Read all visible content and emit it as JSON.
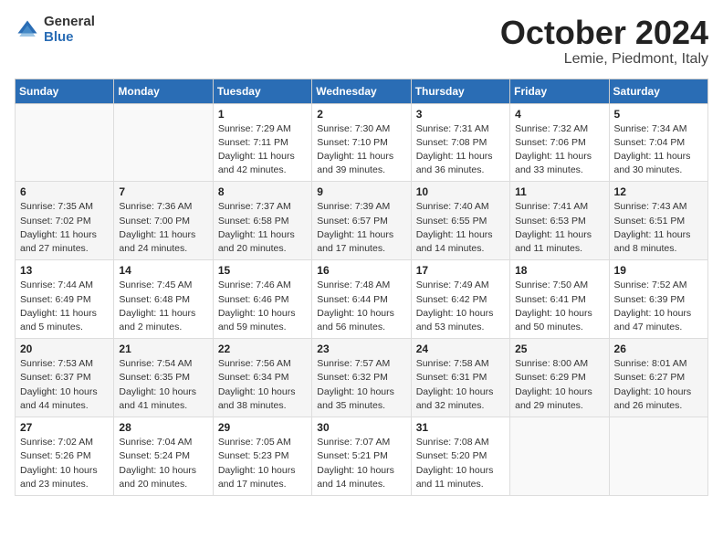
{
  "header": {
    "logo_general": "General",
    "logo_blue": "Blue",
    "title": "October 2024",
    "location": "Lemie, Piedmont, Italy"
  },
  "weekdays": [
    "Sunday",
    "Monday",
    "Tuesday",
    "Wednesday",
    "Thursday",
    "Friday",
    "Saturday"
  ],
  "weeks": [
    [
      {
        "day": "",
        "sunrise": "",
        "sunset": "",
        "daylight": ""
      },
      {
        "day": "",
        "sunrise": "",
        "sunset": "",
        "daylight": ""
      },
      {
        "day": "1",
        "sunrise": "Sunrise: 7:29 AM",
        "sunset": "Sunset: 7:11 PM",
        "daylight": "Daylight: 11 hours and 42 minutes."
      },
      {
        "day": "2",
        "sunrise": "Sunrise: 7:30 AM",
        "sunset": "Sunset: 7:10 PM",
        "daylight": "Daylight: 11 hours and 39 minutes."
      },
      {
        "day": "3",
        "sunrise": "Sunrise: 7:31 AM",
        "sunset": "Sunset: 7:08 PM",
        "daylight": "Daylight: 11 hours and 36 minutes."
      },
      {
        "day": "4",
        "sunrise": "Sunrise: 7:32 AM",
        "sunset": "Sunset: 7:06 PM",
        "daylight": "Daylight: 11 hours and 33 minutes."
      },
      {
        "day": "5",
        "sunrise": "Sunrise: 7:34 AM",
        "sunset": "Sunset: 7:04 PM",
        "daylight": "Daylight: 11 hours and 30 minutes."
      }
    ],
    [
      {
        "day": "6",
        "sunrise": "Sunrise: 7:35 AM",
        "sunset": "Sunset: 7:02 PM",
        "daylight": "Daylight: 11 hours and 27 minutes."
      },
      {
        "day": "7",
        "sunrise": "Sunrise: 7:36 AM",
        "sunset": "Sunset: 7:00 PM",
        "daylight": "Daylight: 11 hours and 24 minutes."
      },
      {
        "day": "8",
        "sunrise": "Sunrise: 7:37 AM",
        "sunset": "Sunset: 6:58 PM",
        "daylight": "Daylight: 11 hours and 20 minutes."
      },
      {
        "day": "9",
        "sunrise": "Sunrise: 7:39 AM",
        "sunset": "Sunset: 6:57 PM",
        "daylight": "Daylight: 11 hours and 17 minutes."
      },
      {
        "day": "10",
        "sunrise": "Sunrise: 7:40 AM",
        "sunset": "Sunset: 6:55 PM",
        "daylight": "Daylight: 11 hours and 14 minutes."
      },
      {
        "day": "11",
        "sunrise": "Sunrise: 7:41 AM",
        "sunset": "Sunset: 6:53 PM",
        "daylight": "Daylight: 11 hours and 11 minutes."
      },
      {
        "day": "12",
        "sunrise": "Sunrise: 7:43 AM",
        "sunset": "Sunset: 6:51 PM",
        "daylight": "Daylight: 11 hours and 8 minutes."
      }
    ],
    [
      {
        "day": "13",
        "sunrise": "Sunrise: 7:44 AM",
        "sunset": "Sunset: 6:49 PM",
        "daylight": "Daylight: 11 hours and 5 minutes."
      },
      {
        "day": "14",
        "sunrise": "Sunrise: 7:45 AM",
        "sunset": "Sunset: 6:48 PM",
        "daylight": "Daylight: 11 hours and 2 minutes."
      },
      {
        "day": "15",
        "sunrise": "Sunrise: 7:46 AM",
        "sunset": "Sunset: 6:46 PM",
        "daylight": "Daylight: 10 hours and 59 minutes."
      },
      {
        "day": "16",
        "sunrise": "Sunrise: 7:48 AM",
        "sunset": "Sunset: 6:44 PM",
        "daylight": "Daylight: 10 hours and 56 minutes."
      },
      {
        "day": "17",
        "sunrise": "Sunrise: 7:49 AM",
        "sunset": "Sunset: 6:42 PM",
        "daylight": "Daylight: 10 hours and 53 minutes."
      },
      {
        "day": "18",
        "sunrise": "Sunrise: 7:50 AM",
        "sunset": "Sunset: 6:41 PM",
        "daylight": "Daylight: 10 hours and 50 minutes."
      },
      {
        "day": "19",
        "sunrise": "Sunrise: 7:52 AM",
        "sunset": "Sunset: 6:39 PM",
        "daylight": "Daylight: 10 hours and 47 minutes."
      }
    ],
    [
      {
        "day": "20",
        "sunrise": "Sunrise: 7:53 AM",
        "sunset": "Sunset: 6:37 PM",
        "daylight": "Daylight: 10 hours and 44 minutes."
      },
      {
        "day": "21",
        "sunrise": "Sunrise: 7:54 AM",
        "sunset": "Sunset: 6:35 PM",
        "daylight": "Daylight: 10 hours and 41 minutes."
      },
      {
        "day": "22",
        "sunrise": "Sunrise: 7:56 AM",
        "sunset": "Sunset: 6:34 PM",
        "daylight": "Daylight: 10 hours and 38 minutes."
      },
      {
        "day": "23",
        "sunrise": "Sunrise: 7:57 AM",
        "sunset": "Sunset: 6:32 PM",
        "daylight": "Daylight: 10 hours and 35 minutes."
      },
      {
        "day": "24",
        "sunrise": "Sunrise: 7:58 AM",
        "sunset": "Sunset: 6:31 PM",
        "daylight": "Daylight: 10 hours and 32 minutes."
      },
      {
        "day": "25",
        "sunrise": "Sunrise: 8:00 AM",
        "sunset": "Sunset: 6:29 PM",
        "daylight": "Daylight: 10 hours and 29 minutes."
      },
      {
        "day": "26",
        "sunrise": "Sunrise: 8:01 AM",
        "sunset": "Sunset: 6:27 PM",
        "daylight": "Daylight: 10 hours and 26 minutes."
      }
    ],
    [
      {
        "day": "27",
        "sunrise": "Sunrise: 7:02 AM",
        "sunset": "Sunset: 5:26 PM",
        "daylight": "Daylight: 10 hours and 23 minutes."
      },
      {
        "day": "28",
        "sunrise": "Sunrise: 7:04 AM",
        "sunset": "Sunset: 5:24 PM",
        "daylight": "Daylight: 10 hours and 20 minutes."
      },
      {
        "day": "29",
        "sunrise": "Sunrise: 7:05 AM",
        "sunset": "Sunset: 5:23 PM",
        "daylight": "Daylight: 10 hours and 17 minutes."
      },
      {
        "day": "30",
        "sunrise": "Sunrise: 7:07 AM",
        "sunset": "Sunset: 5:21 PM",
        "daylight": "Daylight: 10 hours and 14 minutes."
      },
      {
        "day": "31",
        "sunrise": "Sunrise: 7:08 AM",
        "sunset": "Sunset: 5:20 PM",
        "daylight": "Daylight: 10 hours and 11 minutes."
      },
      {
        "day": "",
        "sunrise": "",
        "sunset": "",
        "daylight": ""
      },
      {
        "day": "",
        "sunrise": "",
        "sunset": "",
        "daylight": ""
      }
    ]
  ]
}
